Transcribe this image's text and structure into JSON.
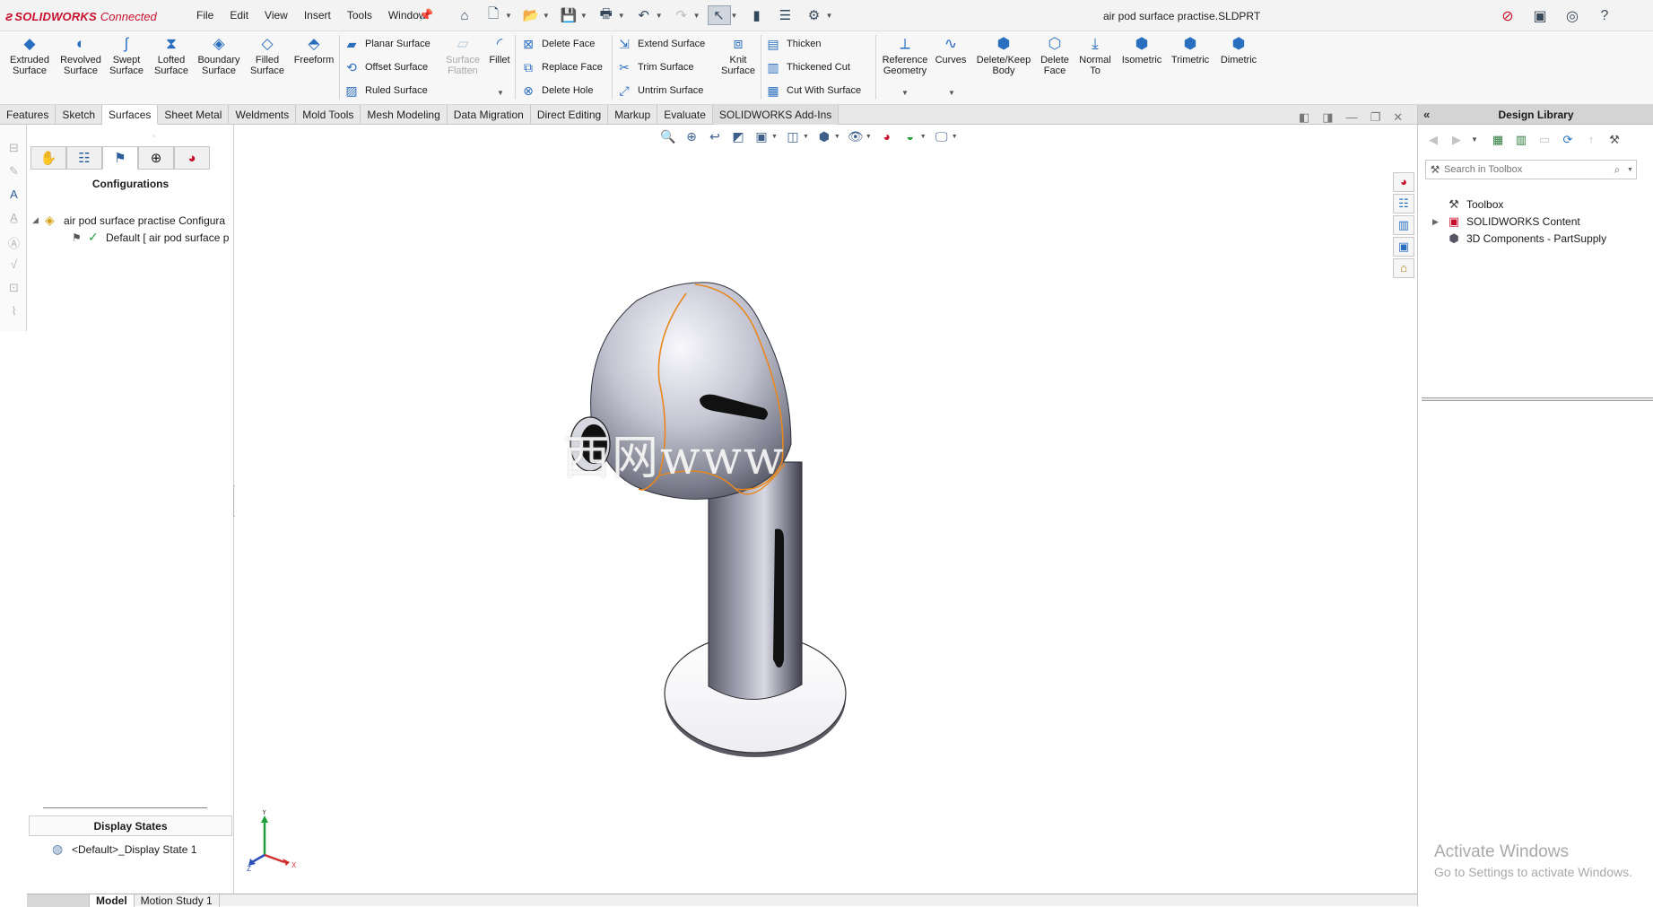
{
  "app": {
    "brand_ds": "3S",
    "brand_name": "SOLIDWORKS",
    "brand_suffix": "Connected",
    "doc_title": "air pod surface practise.SLDPRT"
  },
  "menu": [
    "File",
    "Edit",
    "View",
    "Insert",
    "Tools",
    "Window"
  ],
  "ribbon": {
    "big_buttons": [
      {
        "label1": "Extruded",
        "label2": "Surface"
      },
      {
        "label1": "Revolved",
        "label2": "Surface"
      },
      {
        "label1": "Swept",
        "label2": "Surface"
      },
      {
        "label1": "Lofted",
        "label2": "Surface"
      },
      {
        "label1": "Boundary",
        "label2": "Surface"
      },
      {
        "label1": "Filled",
        "label2": "Surface"
      },
      {
        "label1": "Freeform",
        "label2": ""
      }
    ],
    "group1": [
      "Planar Surface",
      "Offset Surface",
      "Ruled Surface"
    ],
    "surface_flatten": {
      "label1": "Surface",
      "label2": "Flatten"
    },
    "fillet": "Fillet",
    "group2": [
      "Delete Face",
      "Replace Face",
      "Delete Hole"
    ],
    "group3": [
      "Extend Surface",
      "Trim Surface",
      "Untrim Surface"
    ],
    "knit": {
      "label1": "Knit",
      "label2": "Surface"
    },
    "group4": [
      "Thicken",
      "Thickened Cut",
      "Cut With Surface"
    ],
    "right_buttons": [
      {
        "label1": "Reference",
        "label2": "Geometry"
      },
      {
        "label1": "Curves",
        "label2": ""
      },
      {
        "label1": "Delete/Keep",
        "label2": "Body"
      },
      {
        "label1": "Delete",
        "label2": "Face"
      },
      {
        "label1": "Normal",
        "label2": "To"
      },
      {
        "label1": "Isometric",
        "label2": ""
      },
      {
        "label1": "Trimetric",
        "label2": ""
      },
      {
        "label1": "Dimetric",
        "label2": ""
      }
    ]
  },
  "tabs": [
    "Features",
    "Sketch",
    "Surfaces",
    "Sheet Metal",
    "Weldments",
    "Mold Tools",
    "Mesh Modeling",
    "Data Migration",
    "Direct Editing",
    "Markup",
    "Evaluate",
    "SOLIDWORKS Add-Ins"
  ],
  "active_tab": "Surfaces",
  "config_panel": {
    "title": "Configurations",
    "root": "air pod surface practise Configura",
    "child": "Default [ air pod surface p",
    "display_states_title": "Display States",
    "display_state_item": "<Default>_Display State 1"
  },
  "bottom_tabs": [
    "Model",
    "Motion Study 1"
  ],
  "design_library": {
    "title": "Design Library",
    "search_placeholder": "Search in Toolbox",
    "items": [
      "Toolbox",
      "SOLIDWORKS Content",
      "3D Components - PartSupply"
    ]
  },
  "viewport": {
    "watermark": "西网www",
    "triad_y": "Y",
    "triad_x": "X",
    "triad_z": "Z"
  },
  "activation": {
    "line1": "Activate Windows",
    "line2": "Go to Settings to activate Windows."
  },
  "colors": {
    "brand": "#c8102e",
    "accent": "#2a6fbf",
    "edge_highlight": "#e8871e"
  }
}
